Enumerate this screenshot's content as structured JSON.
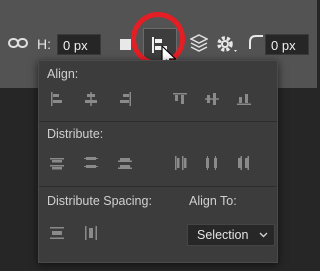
{
  "toolbar": {
    "h_label": "H:",
    "h_value": "0 px",
    "corner_value": "0 px"
  },
  "panel": {
    "align_label": "Align:",
    "distribute_label": "Distribute:",
    "distribute_spacing_label": "Distribute Spacing:",
    "align_to_label": "Align To:",
    "align_to_value": "Selection"
  },
  "colors": {
    "highlight": "#e31e24",
    "toolbar_bg": "#535353",
    "panel_bg": "#3c3c3c"
  },
  "icons": {
    "align_row": [
      "align-left-edges-icon",
      "align-horizontal-centers-icon",
      "align-right-edges-icon",
      "align-top-edges-icon",
      "align-vertical-centers-icon",
      "align-bottom-edges-icon"
    ],
    "distribute_row": [
      "distribute-top-icon",
      "distribute-vertical-centers-icon",
      "distribute-bottom-icon",
      "distribute-left-icon",
      "distribute-horizontal-centers-icon",
      "distribute-right-icon"
    ],
    "spacing_row": [
      "distribute-vertical-spacing-icon",
      "distribute-horizontal-spacing-icon"
    ]
  }
}
